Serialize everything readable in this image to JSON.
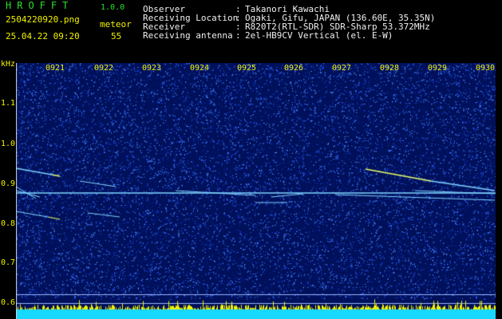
{
  "header": {
    "app_name": "HROFFT",
    "app_version": "1.0.0",
    "filename": "2504220920.png",
    "datetime": "25.04.22 09:20",
    "meteor_label": "meteor",
    "meteor_count": "55"
  },
  "info": [
    {
      "key": "Observer",
      "value": "Takanori Kawachi"
    },
    {
      "key": "Receiving Location",
      "value": "Ogaki, Gifu, JAPAN (136.60E, 35.35N)"
    },
    {
      "key": "Receiver",
      "value": "R820T2(RTL-SDR) SDR-Sharp 53.372MHz"
    },
    {
      "key": "Receiving antenna",
      "value": "2el-HB9CV Vertical (el. E-W)"
    }
  ],
  "axis": {
    "unit": "kHz",
    "y_ticks": [
      "1.1",
      "1.0",
      "0.9",
      "0.8",
      "0.7",
      "0.6"
    ],
    "x_ticks": [
      "0921",
      "0922",
      "0923",
      "0924",
      "0925",
      "0926",
      "0927",
      "0928",
      "0929",
      "0930"
    ]
  },
  "colors": {
    "background": "#000000",
    "plot_background": "#00105a",
    "noise": "#2a5cff",
    "trace": "#7fd4ff",
    "meteor_hot": "#e8ff6a",
    "label": "#f2f200",
    "title": "#27e027",
    "spectrum_yellow": "#f2f200",
    "spectrum_cyan": "#18d8ff"
  }
}
